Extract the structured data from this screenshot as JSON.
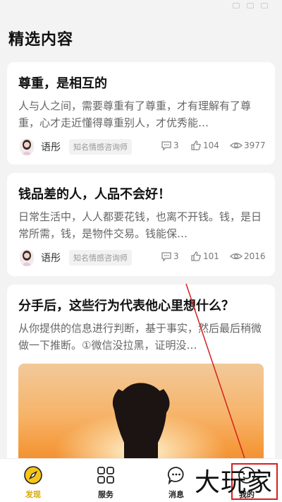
{
  "page": {
    "title": "精选内容"
  },
  "articles": [
    {
      "title": "尊重，是相互的",
      "excerpt": "人与人之间，需要尊重有了尊重，才有理解有了尊重，心才走近懂得尊重别人，才优秀能…",
      "author": "语彤",
      "badge": "知名情感咨询师",
      "comments": "3",
      "likes": "104",
      "views": "3977"
    },
    {
      "title": "钱品差的人，人品不会好！",
      "excerpt": "日常生活中，人人都要花钱，也离不开钱。钱，是日常所需，钱，是物件交易。钱能保…",
      "author": "语彤",
      "badge": "知名情感咨询师",
      "comments": "3",
      "likes": "101",
      "views": "2016"
    },
    {
      "title": "分手后，这些行为代表他心里想什么？",
      "excerpt": "从你提供的信息进行判断，基于事实，然后最后稍微做一下推断。①微信没拉黑，证明没…"
    }
  ],
  "tabs": {
    "discover": "发现",
    "services": "服务",
    "messages": "消息",
    "mine": "我的"
  },
  "icons": {
    "discover": "compass-icon",
    "services": "grid-icon",
    "messages": "chat-bubble-icon",
    "mine": "smiley-icon",
    "comments": "comment-icon",
    "likes": "thumbs-up-icon",
    "views": "eye-icon"
  },
  "colors": {
    "accent": "#f5c518",
    "annotation": "#d62020"
  },
  "watermark": "大玩家"
}
